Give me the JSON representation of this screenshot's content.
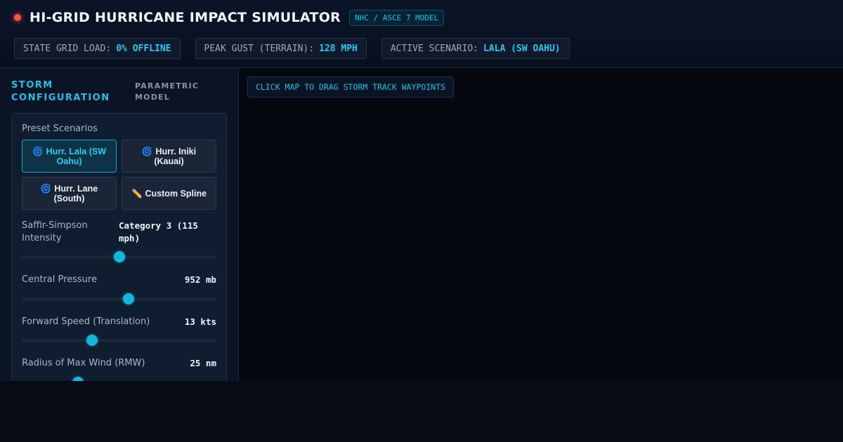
{
  "header": {
    "title": "HI-GRID HURRICANE IMPACT SIMULATOR",
    "model_badge": "NHC / ASCE 7 MODEL",
    "status_color": "#ff4d4d",
    "stats": [
      {
        "label": "STATE GRID LOAD:",
        "value": "0% OFFLINE"
      },
      {
        "label": "PEAK GUST (TERRAIN):",
        "value": "128 MPH"
      },
      {
        "label": "ACTIVE SCENARIO:",
        "value": "LALA (SW OAHU)"
      }
    ]
  },
  "sidebar": {
    "title": "STORM CONFIGURATION",
    "subtitle": "PARAMETRIC MODEL",
    "presets_label": "Preset Scenarios",
    "presets": [
      {
        "icon": "🌀",
        "label": "Hurr. Lala (SW Oahu)",
        "active": true
      },
      {
        "icon": "🌀",
        "label": "Hurr. Iniki (Kauai)",
        "active": false
      },
      {
        "icon": "🌀",
        "label": "Hurr. Lane (South)",
        "active": false
      },
      {
        "icon": "✏️",
        "label": "Custom Spline",
        "active": false
      }
    ],
    "params": [
      {
        "label": "Saffir-Simpson Intensity",
        "value": "Category 3 (115 mph)",
        "level": 0.5
      },
      {
        "label": "Central Pressure",
        "value": "952 mb",
        "level": 0.55
      },
      {
        "label": "Forward Speed (Translation)",
        "value": "13 kts",
        "level": 0.36
      },
      {
        "label": "Radius of Max Wind (RMW)",
        "value": "25 nm",
        "level": 0.29
      }
    ]
  },
  "map": {
    "hint": "CLICK MAP TO DRAG STORM TRACK WAYPOINTS"
  },
  "colors": {
    "accent": "#22c7e8",
    "background": "#050a14",
    "alert": "#ff4d4d"
  }
}
